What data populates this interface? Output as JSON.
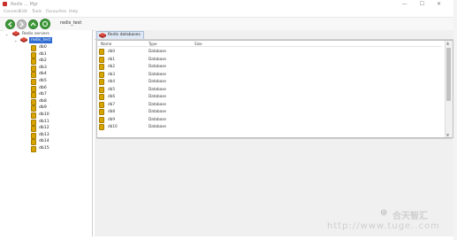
{
  "titlebar": {
    "title": "Redis ... Mgr"
  },
  "menubar": {
    "items": [
      "Connect",
      "Edit",
      "Tools",
      "Favourites",
      "Help"
    ]
  },
  "toolbar": {
    "connection_label": "redis_test"
  },
  "tree": {
    "root_label": "Redis servers",
    "server_label": "redis_test",
    "databases": [
      "db0",
      "db1",
      "db2",
      "db3",
      "db4",
      "db5",
      "db6",
      "db7",
      "db8",
      "db9",
      "db10",
      "db11",
      "db12",
      "db13",
      "db14",
      "db15"
    ]
  },
  "tab": {
    "label": "Redis databases"
  },
  "table": {
    "columns": [
      "Name",
      "Type",
      "Size"
    ],
    "rows": [
      {
        "name": "db0",
        "type": "Database",
        "size": ""
      },
      {
        "name": "db1",
        "type": "Database",
        "size": ""
      },
      {
        "name": "db2",
        "type": "Database",
        "size": ""
      },
      {
        "name": "db3",
        "type": "Database",
        "size": ""
      },
      {
        "name": "db4",
        "type": "Database",
        "size": ""
      },
      {
        "name": "db5",
        "type": "Database",
        "size": ""
      },
      {
        "name": "db6",
        "type": "Database",
        "size": ""
      },
      {
        "name": "db7",
        "type": "Database",
        "size": ""
      },
      {
        "name": "db8",
        "type": "Database",
        "size": ""
      },
      {
        "name": "db9",
        "type": "Database",
        "size": ""
      },
      {
        "name": "db10",
        "type": "Database",
        "size": ""
      }
    ]
  },
  "watermark": {
    "text": "合天智汇",
    "url": "http://www.tuge..com"
  },
  "colors": {
    "accent": "#2f6bd1",
    "redis_red": "#c9302c",
    "db_gold": "#d8a400",
    "toolbar_green": "#3f9a3a"
  }
}
